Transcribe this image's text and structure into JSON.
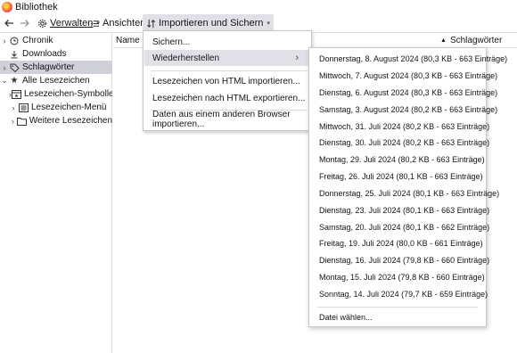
{
  "window": {
    "title": "Bibliothek"
  },
  "toolbar": {
    "back_icon": "back-arrow-icon",
    "forward_icon": "forward-arrow-icon",
    "manage_label": "Verwalten",
    "views_label": "Ansichten",
    "import_label": "Importieren und Sichern"
  },
  "sidebar": {
    "items": [
      {
        "label": "Chronik",
        "icon": "clock-icon",
        "expandable": true
      },
      {
        "label": "Downloads",
        "icon": "download-icon",
        "expandable": false
      },
      {
        "label": "Schlagwörter",
        "icon": "tag-icon",
        "expandable": true,
        "selected": true
      },
      {
        "label": "Alle Lesezeichen",
        "icon": "star-icon",
        "expandable": true,
        "expanded": true
      },
      {
        "label": "Lesezeichen-Symbolleist...",
        "icon": "toolbar-icon",
        "expandable": true
      },
      {
        "label": "Lesezeichen-Menü",
        "icon": "menu-list-icon",
        "expandable": true
      },
      {
        "label": "Weitere Lesezeichen",
        "icon": "folder-icon",
        "expandable": true
      }
    ]
  },
  "columns": {
    "name": "Name",
    "tags": "Schlagwörter"
  },
  "import_menu": {
    "backup": "Sichern...",
    "restore": "Wiederherstellen",
    "import_html": "Lesezeichen von HTML importieren...",
    "export_html": "Lesezeichen nach HTML exportieren...",
    "import_browser": "Daten aus einem anderen Browser importieren..."
  },
  "restore_menu": {
    "backups": [
      "Donnerstag, 8. August 2024 (80,3 KB - 663 Einträge)",
      "Mittwoch, 7. August 2024 (80,3 KB - 663 Einträge)",
      "Dienstag, 6. August 2024 (80,3 KB - 663 Einträge)",
      "Samstag, 3. August 2024 (80,2 KB - 663 Einträge)",
      "Mittwoch, 31. Juli 2024 (80,2 KB - 663 Einträge)",
      "Dienstag, 30. Juli 2024 (80,2 KB - 663 Einträge)",
      "Montag, 29. Juli 2024 (80,2 KB - 663 Einträge)",
      "Freitag, 26. Juli 2024 (80,1 KB - 663 Einträge)",
      "Donnerstag, 25. Juli 2024 (80,1 KB - 663 Einträge)",
      "Dienstag, 23. Juli 2024 (80,1 KB - 663 Einträge)",
      "Samstag, 20. Juli 2024 (80,1 KB - 662 Einträge)",
      "Freitag, 19. Juli 2024 (80,0 KB - 661 Einträge)",
      "Dienstag, 16. Juli 2024 (79,8 KB - 660 Einträge)",
      "Montag, 15. Juli 2024 (79,8 KB - 660 Einträge)",
      "Sonntag, 14. Juli 2024 (79,7 KB - 659 Einträge)"
    ],
    "choose_file": "Datei wählen..."
  },
  "colors": {
    "selected_row": "#d0d0d7",
    "menu_highlight": "#e0e0e6"
  }
}
